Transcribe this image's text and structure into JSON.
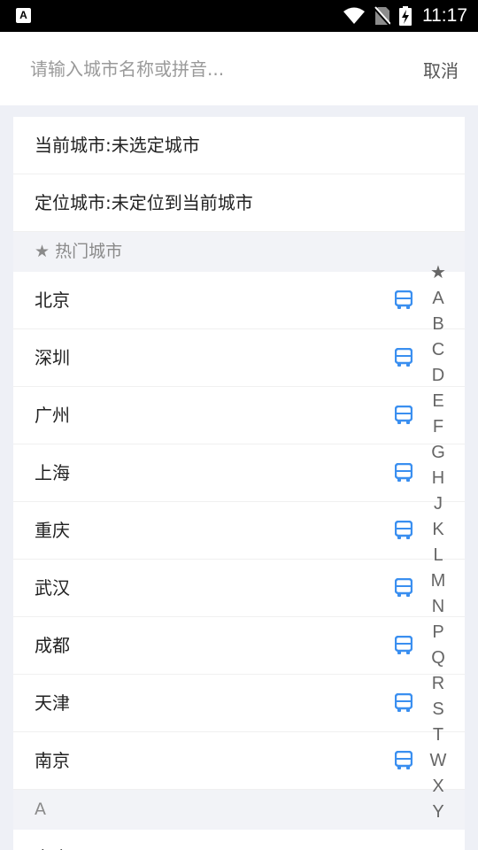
{
  "status_bar": {
    "app_icon": "A",
    "time": "11:17",
    "icons": [
      "wifi-icon",
      "no-sim-icon",
      "battery-charging-icon"
    ]
  },
  "search": {
    "placeholder": "请输入城市名称或拼音...",
    "value": "",
    "cancel_label": "取消"
  },
  "list": {
    "current_city": "当前城市:未选定城市",
    "located_city": "定位城市:未定位到当前城市",
    "hot_header": "★ 热门城市",
    "hot_cities": [
      "北京",
      "深圳",
      "广州",
      "上海",
      "重庆",
      "武汉",
      "成都",
      "天津",
      "南京"
    ],
    "section_a_header": "A",
    "section_a_cities": [
      "安庆"
    ]
  },
  "index_bar": [
    "★",
    "A",
    "B",
    "C",
    "D",
    "E",
    "F",
    "G",
    "H",
    "J",
    "K",
    "L",
    "M",
    "N",
    "P",
    "Q",
    "R",
    "S",
    "T",
    "W",
    "X",
    "Y"
  ],
  "colors": {
    "accent": "#3a8ff0",
    "section_bg": "#f2f3f7",
    "page_bg": "#eef0f6"
  }
}
